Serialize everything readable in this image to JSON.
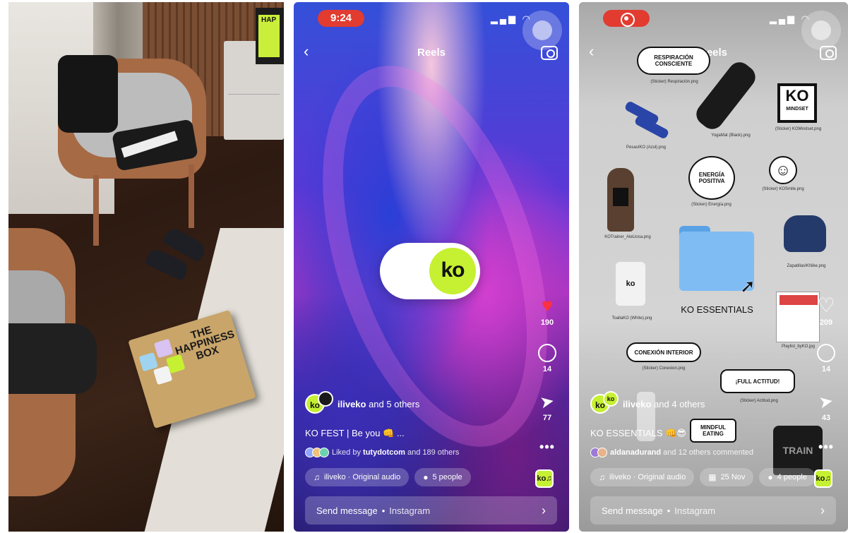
{
  "reel_screen": {
    "status_time": "9:24",
    "nav_title": "Reels",
    "toggle_logo": "ko",
    "likes_count": "190",
    "comments_count": "14",
    "shares_count": "77",
    "owner_name": "iliveko",
    "owner_suffix": " and 5 others",
    "caption": "KO FEST | Be you 👊 ...",
    "liked_prefix": "Liked by ",
    "liked_user": "tutydotcom",
    "liked_suffix": " and 189 others",
    "audio_chip": "iliveko · Original audio",
    "people_chip": "5 people",
    "send_label": "Send message",
    "send_sub": "Instagram"
  },
  "essentials_screen": {
    "nav_title": "Reels",
    "likes_count": "209",
    "comments_count": "14",
    "shares_count": "43",
    "owner_name": "iliveko",
    "owner_suffix": " and 4 others",
    "caption": "KO ESSENTIALS 👊😎",
    "commenter_user": "aldanadurand",
    "commenter_suffix": " and 12 others commented",
    "audio_chip": "iliveko · Original audio",
    "date_chip": "25 Nov",
    "people_chip": "4 people",
    "send_label": "Send message",
    "send_sub": "Instagram",
    "folder_label": "KO ESSENTIALS",
    "stickers": {
      "respiracion": "RESPIRACIÓN CONSCIENTE",
      "respiracion_file": "(Sticker) Respiración.png",
      "yogamat_file": "YogaMat (Black).png",
      "mindset_logo": "KO",
      "mindset_text": "MINDSET",
      "mindset_file": "(Sticker) KOMindset.png",
      "pesas_file": "PesasIKO (Azul).png",
      "energia": "ENERGÍA POSITIVA",
      "energia_file": "(Sticker) Energía.png",
      "smile_file": "(Sticker) KOSmile.png",
      "trainer_file": "KOTrainer_AleLlosa.png",
      "zapatillas_file": "ZapatillasIKNike.png",
      "toalla_file": "ToallaKO (White).png",
      "playlist_file": "Playlist_byKO.jpg",
      "conexion": "CONEXIÓN INTERIOR",
      "conexion_file": "(Sticker) Conexion.png",
      "actitud": "¡FULL ACTITUD!",
      "actitud_file": "(Sticker) Actitud.png",
      "mindful": "MINDFUL EATING",
      "bag_text": "TRAIN"
    }
  },
  "photo": {
    "box_text": "THE HAPPINESS BOX",
    "screen_text": "HAP"
  },
  "colors": {
    "brand_lime": "#c6f032",
    "like_red": "#ff3040",
    "record_red": "#e23b30"
  },
  "icons": {
    "back": "chevron-left-icon",
    "camera": "camera-icon",
    "heart": "heart-icon",
    "comment": "comment-icon",
    "share": "paper-plane-icon",
    "more": "more-icon",
    "music": "music-note-icon",
    "person": "person-icon",
    "calendar": "calendar-icon",
    "cursor": "mouse-cursor-icon"
  }
}
